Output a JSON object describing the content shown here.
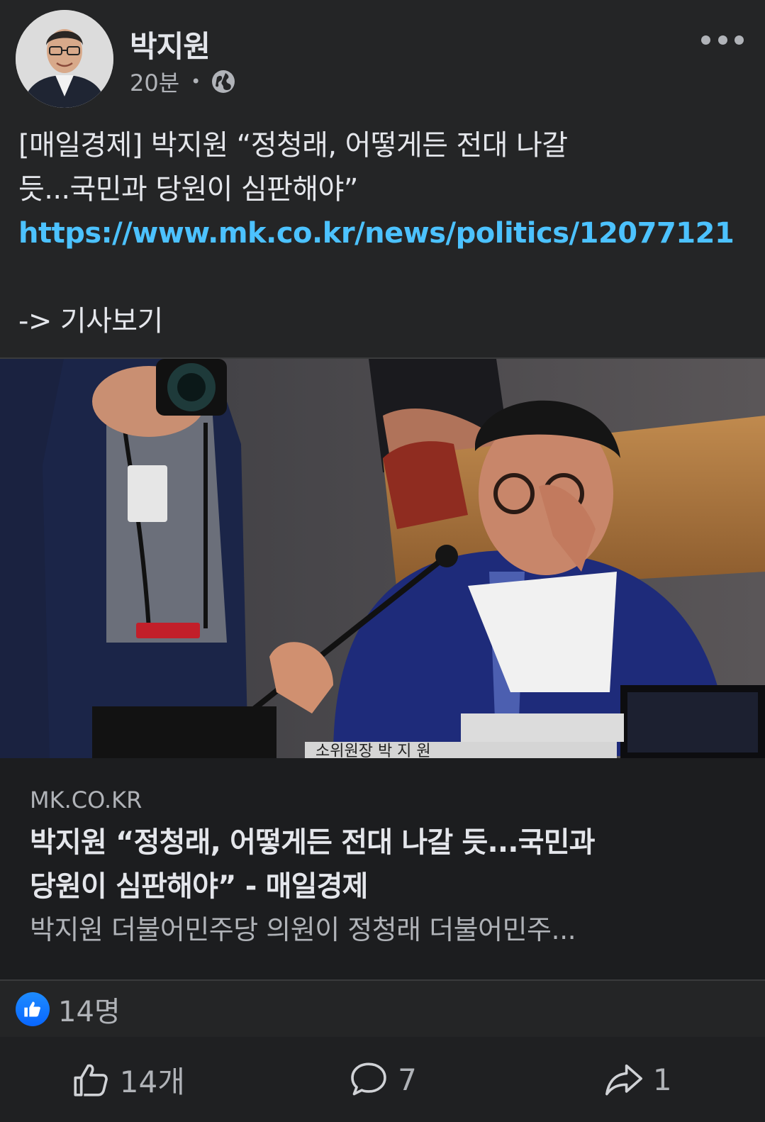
{
  "post": {
    "author": "박지원",
    "time": "20분",
    "separator": "•",
    "privacy_icon": "globe-icon",
    "text_line1": "[매일경제] 박지원 “정청래, 어떻게든 전대 나갈",
    "text_line2": "듯...국민과 당원이 심판해야”",
    "link": "https://www.mk.co.kr/news/politics/12077121",
    "cta": "-> 기사보기"
  },
  "photo": {
    "nameplate": "소위원장   박   지   원"
  },
  "link_card": {
    "domain": "MK.CO.KR",
    "title_line1": "박지원 “정청래, 어떻게든 전대 나갈 듯...국민과",
    "title_line2": "당원이 심판해야” - 매일경제",
    "description": "박지원 더불어민주당 의원이 정청래 더불어민주..."
  },
  "reactions": {
    "icon": "like-icon",
    "count": "14명"
  },
  "actions": {
    "like": "14개",
    "comment": "7",
    "share": "1"
  },
  "colors": {
    "background": "#242526",
    "card": "#1c1d1f",
    "link": "#4cc2ff",
    "like_badge": "#0866ff",
    "text": "#e4e6eb",
    "muted": "#b0b3b8"
  }
}
